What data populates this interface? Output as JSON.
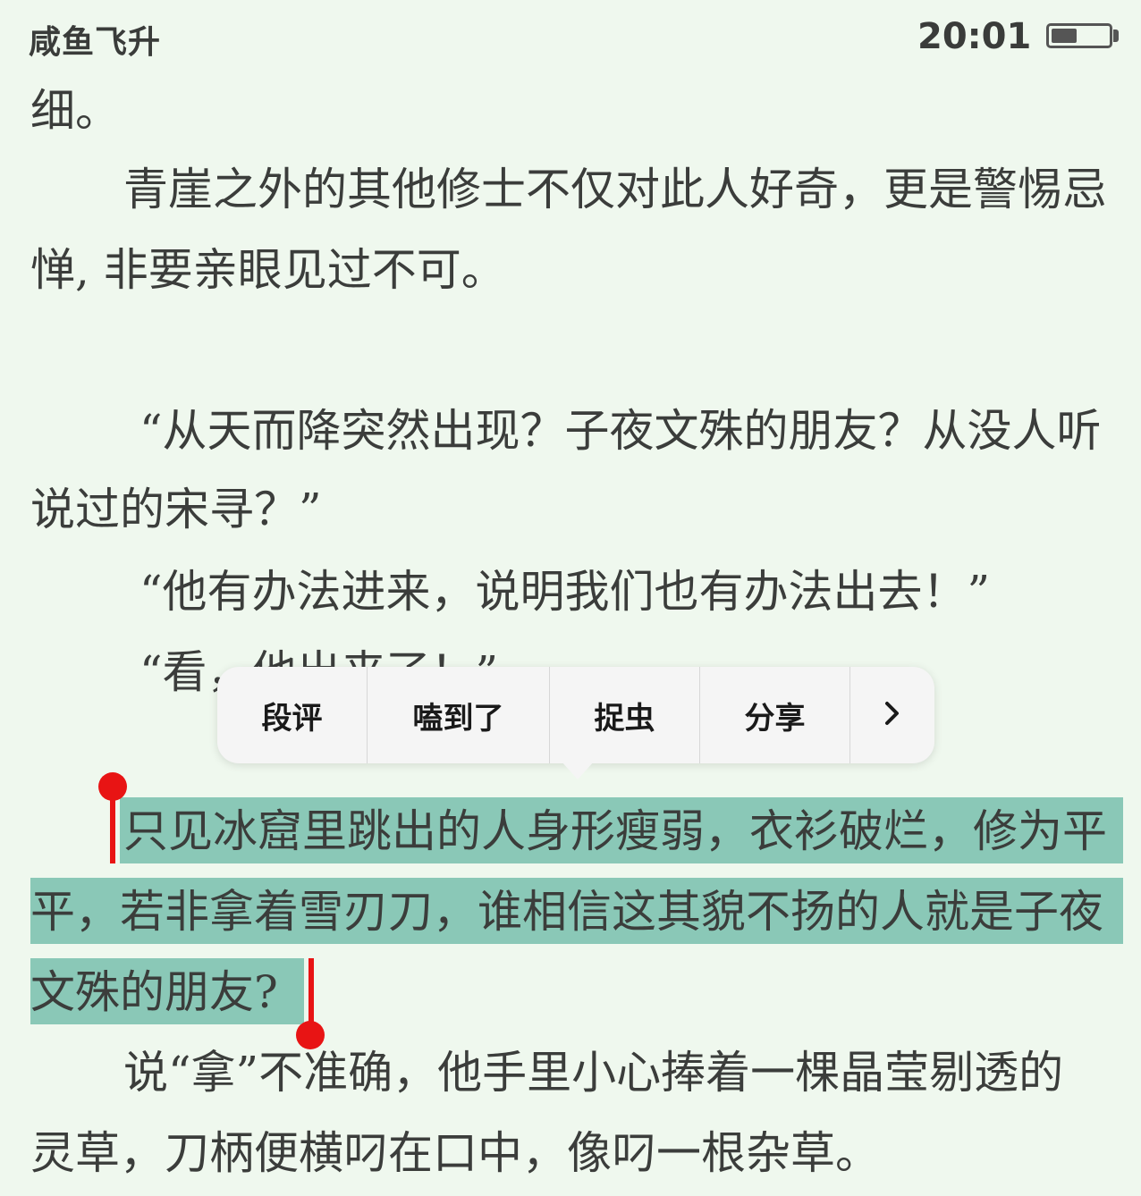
{
  "status": {
    "book_title": "咸鱼飞升",
    "time": "20:01",
    "battery_level": 0.45
  },
  "lines": [
    "细。",
    "青崖之外的其他修士不仅对此人好奇，更是警惕忌",
    "惮, 非要亲眼见过不可。",
    "“从天而降突然出现？子夜文殊的朋友？从没人听",
    "说过的宋寻？”",
    "“他有办法进来，说明我们也有办法出去！”",
    "“看，他出来了！”",
    "只见冰窟里跳出的人身形瘦弱，衣衫破烂，修为平",
    "平，若非拿着雪刃刀，谁相信这其貌不扬的人就是子夜",
    "文殊的朋友?",
    "说“拿”不准确，他手里小心捧着一棵晶莹剔透的",
    "灵草，刀柄便横叼在口中，像叼一根杂草。"
  ],
  "menu": {
    "items": [
      "段评",
      "嗑到了",
      "捉虫",
      "分享"
    ],
    "more_icon": "chevron-right-icon"
  },
  "colors": {
    "background": "#eff8ee",
    "highlight": "#8ac8b7",
    "handle": "#e81414"
  }
}
